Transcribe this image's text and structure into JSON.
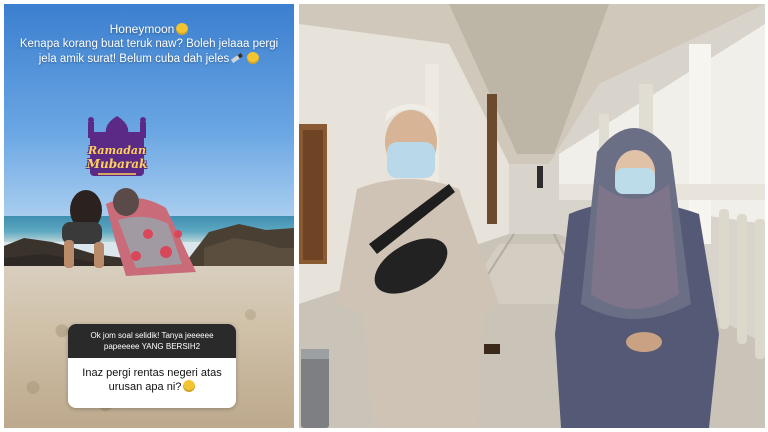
{
  "story": {
    "caption_title": "Honeymoon",
    "caption_text": "Kenapa korang buat teruk naw? Boleh jelaaa pergi jela amik surat! Belum cuba dah jeles",
    "sticker_line1": "Ramadan",
    "sticker_line2": "Mubarak",
    "question_prompt": "Ok jom soal selidik! Tanya jeeeeee papeeeee YANG BERSIH2",
    "question_answer": "Inaz pergi rentas negeri atas urusan apa ni?"
  },
  "colors": {
    "question_header_bg": "#2a2a2a",
    "sticker_purple": "#5b2a86",
    "sticker_gold": "#ffd05a"
  }
}
